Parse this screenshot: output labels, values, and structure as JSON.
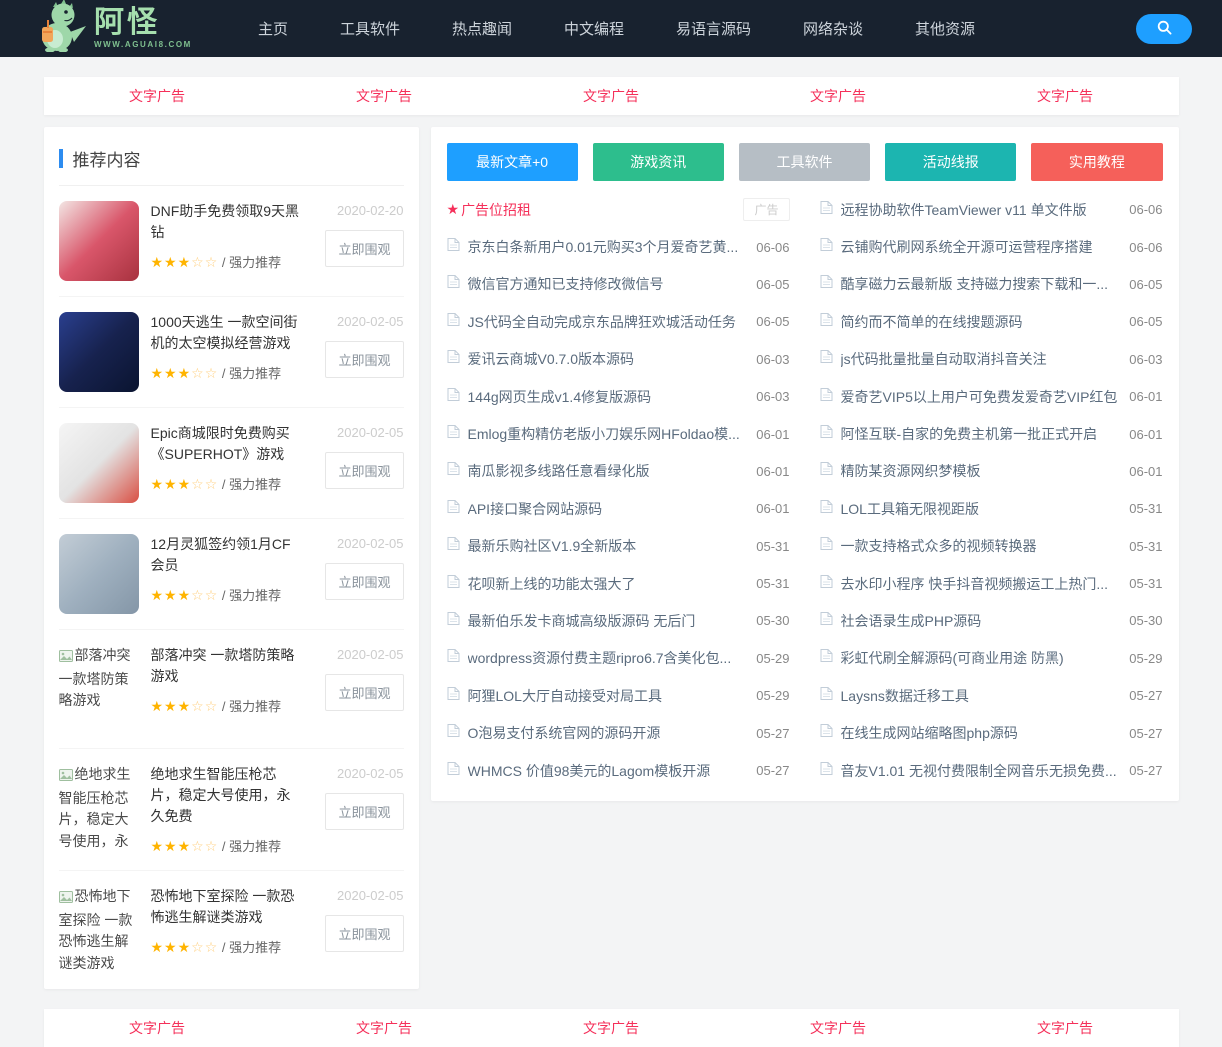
{
  "colors": {
    "accent_red": "#f5305a",
    "nav_bg": "#18222f",
    "search_blue": "#1E9FFF",
    "header_bar_blue": "#2d8cf0",
    "star_gold": "#ffb400"
  },
  "brand": {
    "site_name": "阿怪",
    "site_url": "WWW.AGUAI8.COM"
  },
  "navbar": {
    "items": [
      {
        "label": "主页"
      },
      {
        "label": "工具软件"
      },
      {
        "label": "热点趣闻"
      },
      {
        "label": "中文编程"
      },
      {
        "label": "易语言源码"
      },
      {
        "label": "网络杂谈"
      },
      {
        "label": "其他资源"
      }
    ]
  },
  "ads": {
    "top": [
      "文字广告",
      "文字广告",
      "文字广告",
      "文字广告",
      "文字广告"
    ],
    "bottom": [
      "文字广告",
      "文字广告",
      "文字广告",
      "文字广告",
      "文字广告"
    ]
  },
  "recommended": {
    "header": "推荐内容",
    "stars_full_text": "★★★",
    "stars_empty_text": "☆☆",
    "rating_suffix": "/ 强力推荐",
    "action_label": "立即围观",
    "items": [
      {
        "title": "DNF助手免费领取9天黑钻",
        "date": "2020-02-20",
        "thumb_type": "image",
        "thumb_colors": [
          "#f3e6e4",
          "#d9566a",
          "#a8323f"
        ]
      },
      {
        "title": "1000天逃生 一款空间街机的太空模拟经营游戏",
        "date": "2020-02-05",
        "thumb_type": "image",
        "thumb_colors": [
          "#2a3f8f",
          "#17224e",
          "#0a1430"
        ]
      },
      {
        "title": "Epic商城限时免费购买《SUPERHOT》游戏",
        "date": "2020-02-05",
        "thumb_type": "image",
        "thumb_colors": [
          "#f5f5f5",
          "#e3e3e3",
          "#d94f43"
        ]
      },
      {
        "title": "12月灵狐签约领1月CF会员",
        "date": "2020-02-05",
        "thumb_type": "image",
        "thumb_colors": [
          "#c3cdd6",
          "#9fb0bf",
          "#8496a7"
        ]
      },
      {
        "title": "部落冲突 一款塔防策略游戏",
        "date": "2020-02-05",
        "thumb_type": "broken"
      },
      {
        "title": "绝地求生智能压枪芯片，稳定大号使用，永久免费",
        "date": "2020-02-05",
        "thumb_type": "broken"
      },
      {
        "title": "恐怖地下室探险 一款恐怖逃生解谜类游戏",
        "date": "2020-02-05",
        "thumb_type": "broken"
      }
    ]
  },
  "category_buttons": [
    {
      "label": "最新文章+0",
      "color": "#1E9FFF"
    },
    {
      "label": "游戏资讯",
      "color": "#2dbe8d"
    },
    {
      "label": "工具软件",
      "color": "#b6bec5"
    },
    {
      "label": "活动线报",
      "color": "#1cb5b0"
    },
    {
      "label": "实用教程",
      "color": "#f5605a"
    }
  ],
  "article_list": {
    "ad_row": {
      "star": "★",
      "label": "广告位招租",
      "badge": "广告"
    },
    "left": [
      {
        "title": "京东白条新用户0.01元购买3个月爱奇艺黄...",
        "date": "06-06"
      },
      {
        "title": "微信官方通知已支持修改微信号",
        "date": "06-05"
      },
      {
        "title": "JS代码全自动完成京东品牌狂欢城活动任务",
        "date": "06-05"
      },
      {
        "title": "爱讯云商城V0.7.0版本源码",
        "date": "06-03"
      },
      {
        "title": "144g网页生成v1.4修复版源码",
        "date": "06-03"
      },
      {
        "title": "Emlog重构精仿老版小刀娱乐网HFoldao模...",
        "date": "06-01"
      },
      {
        "title": "南瓜影视多线路任意看绿化版",
        "date": "06-01"
      },
      {
        "title": "API接口聚合网站源码",
        "date": "06-01"
      },
      {
        "title": "最新乐购社区V1.9全新版本",
        "date": "05-31"
      },
      {
        "title": "花呗新上线的功能太强大了",
        "date": "05-31"
      },
      {
        "title": "最新伯乐发卡商城高级版源码 无后门",
        "date": "05-30"
      },
      {
        "title": "wordpress资源付费主题ripro6.7含美化包...",
        "date": "05-29"
      },
      {
        "title": "阿狸LOL大厅自动接受对局工具",
        "date": "05-29"
      },
      {
        "title": "O泡易支付系统官网的源码开源",
        "date": "05-27"
      },
      {
        "title": "WHMCS 价值98美元的Lagom模板开源",
        "date": "05-27"
      }
    ],
    "right": [
      {
        "title": "远程协助软件TeamViewer v11 单文件版",
        "date": "06-06"
      },
      {
        "title": "云铺购代刷网系统全开源可运营程序搭建",
        "date": "06-06"
      },
      {
        "title": "酷享磁力云最新版 支持磁力搜索下载和一...",
        "date": "06-05"
      },
      {
        "title": "简约而不简单的在线搜题源码",
        "date": "06-05"
      },
      {
        "title": "js代码批量批量自动取消抖音关注",
        "date": "06-03"
      },
      {
        "title": "爱奇艺VIP5以上用户可免费发爱奇艺VIP红包",
        "date": "06-01"
      },
      {
        "title": "阿怪互联-自家的免费主机第一批正式开启",
        "date": "06-01"
      },
      {
        "title": "精防某资源网织梦模板",
        "date": "06-01"
      },
      {
        "title": "LOL工具箱无限视距版",
        "date": "05-31"
      },
      {
        "title": "一款支持格式众多的视频转换器",
        "date": "05-31"
      },
      {
        "title": "去水印小程序 快手抖音视频搬运工上热门...",
        "date": "05-31"
      },
      {
        "title": "社会语录生成PHP源码",
        "date": "05-30"
      },
      {
        "title": "彩虹代刷全解源码(可商业用途 防黑)",
        "date": "05-29"
      },
      {
        "title": "Laysns数据迁移工具",
        "date": "05-27"
      },
      {
        "title": "在线生成网站缩略图php源码",
        "date": "05-27"
      },
      {
        "title": "音友V1.01 无视付费限制全网音乐无损免费...",
        "date": "05-27"
      }
    ]
  }
}
